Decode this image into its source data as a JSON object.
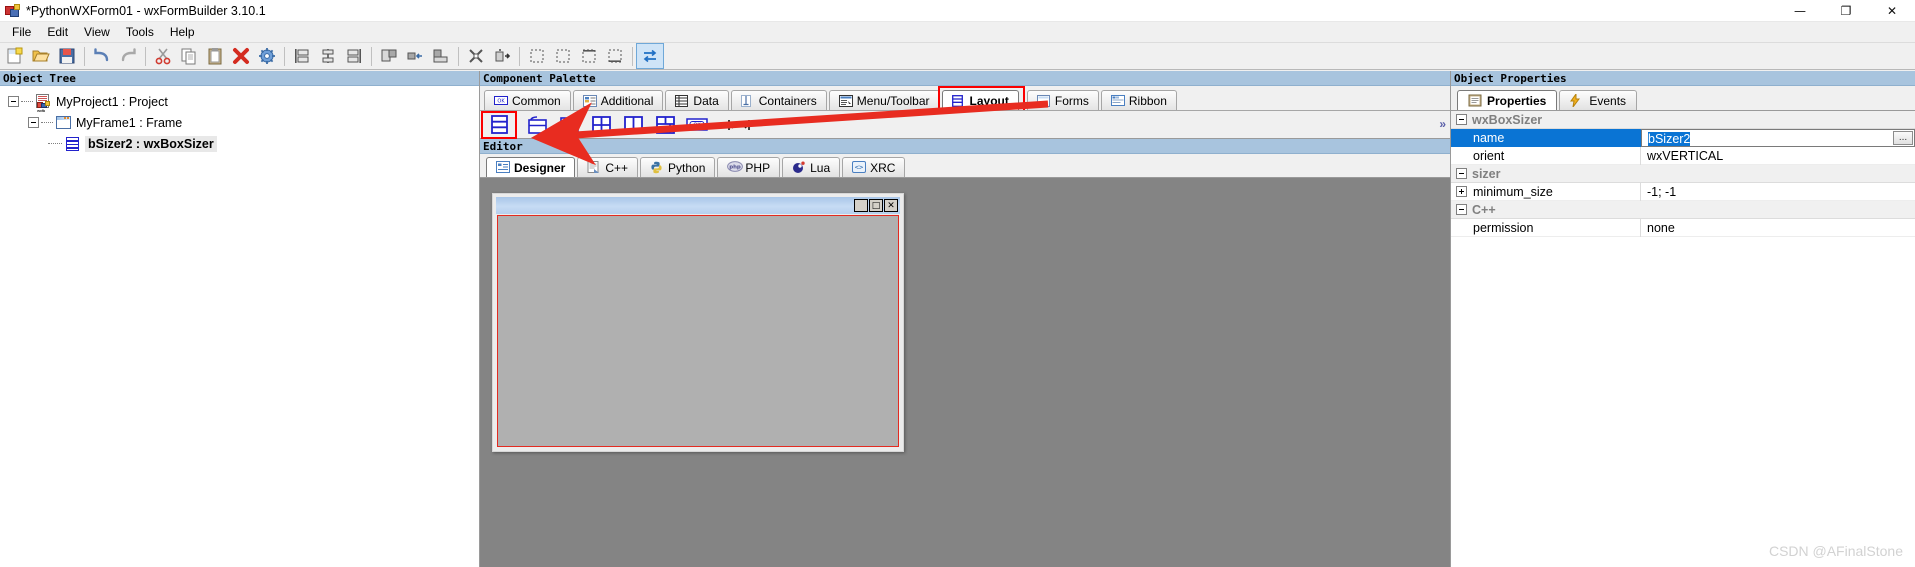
{
  "window": {
    "title": "*PythonWXForm01 - wxFormBuilder 3.10.1",
    "icon": "wxfb-icon",
    "controls": {
      "minimize": "—",
      "maximize": "❐",
      "close": "✕"
    }
  },
  "menubar": {
    "items": [
      {
        "label": "File"
      },
      {
        "label": "Edit"
      },
      {
        "label": "View"
      },
      {
        "label": "Tools"
      },
      {
        "label": "Help"
      }
    ]
  },
  "toolbar": {
    "buttons": [
      {
        "name": "new-project-button",
        "icon": "new-document-icon"
      },
      {
        "name": "open-project-button",
        "icon": "open-folder-icon"
      },
      {
        "name": "save-project-button",
        "icon": "floppy-save-icon"
      },
      {
        "name": "undo-button",
        "icon": "undo-arrow-icon"
      },
      {
        "name": "redo-button",
        "icon": "redo-arrow-icon"
      },
      {
        "name": "cut-button",
        "icon": "scissors-icon"
      },
      {
        "name": "copy-button",
        "icon": "copy-pages-icon"
      },
      {
        "name": "paste-button",
        "icon": "clipboard-icon"
      },
      {
        "name": "delete-button",
        "icon": "red-x-icon"
      },
      {
        "name": "settings-button",
        "icon": "gear-icon"
      },
      {
        "name": "align-left-button",
        "icon": "align-left-icon"
      },
      {
        "name": "align-center-button",
        "icon": "align-center-icon"
      },
      {
        "name": "align-right-button",
        "icon": "align-right-icon"
      },
      {
        "name": "align-top-button",
        "icon": "align-top-icon"
      },
      {
        "name": "align-middle-button",
        "icon": "align-middle-icon"
      },
      {
        "name": "align-bottom-button",
        "icon": "align-bottom-icon"
      },
      {
        "name": "expand-button",
        "icon": "expand-arrows-icon"
      },
      {
        "name": "stretch-button",
        "icon": "stretch-icon"
      },
      {
        "name": "border-left-button",
        "icon": "border-left-icon"
      },
      {
        "name": "border-right-button",
        "icon": "border-right-icon"
      },
      {
        "name": "border-top-button",
        "icon": "border-top-icon"
      },
      {
        "name": "border-bottom-button",
        "icon": "border-bottom-icon"
      },
      {
        "name": "toggle-orient-button",
        "icon": "swap-arrows-icon"
      }
    ]
  },
  "object_tree": {
    "caption": "Object Tree",
    "nodes": [
      {
        "label": "MyProject1 : Project",
        "icon": "project-icon",
        "depth": 0,
        "expanded": true,
        "selected": false
      },
      {
        "label": "MyFrame1 : Frame",
        "icon": "frame-icon",
        "depth": 1,
        "expanded": true,
        "selected": false
      },
      {
        "label": "bSizer2 : wxBoxSizer",
        "icon": "boxsizer-icon",
        "depth": 2,
        "expanded": false,
        "selected": true
      }
    ]
  },
  "component_palette": {
    "caption": "Component Palette",
    "tabs": [
      {
        "label": "Common",
        "icon": "button-widget-icon",
        "selected": false
      },
      {
        "label": "Additional",
        "icon": "list-widget-icon",
        "selected": false
      },
      {
        "label": "Data",
        "icon": "grid-data-icon",
        "selected": false
      },
      {
        "label": "Containers",
        "icon": "container-icon",
        "selected": false
      },
      {
        "label": "Menu/Toolbar",
        "icon": "menubar-icon",
        "selected": false
      },
      {
        "label": "Layout",
        "icon": "boxsizer-icon",
        "selected": true
      },
      {
        "label": "Forms",
        "icon": "form-window-icon",
        "selected": false
      },
      {
        "label": "Ribbon",
        "icon": "ribbon-icon",
        "selected": false
      }
    ],
    "overflow_indicator": "»",
    "items": [
      {
        "name": "wxBoxSizer-button",
        "icon": "boxsizer-icon",
        "selected": true
      },
      {
        "name": "wxStaticBoxSizer-button",
        "icon": "staticboxsizer-icon",
        "selected": false
      },
      {
        "name": "wxWrapSizer-button",
        "icon": "wrapsizer-icon",
        "selected": false
      },
      {
        "name": "wxGridSizer-button",
        "icon": "gridsizer-icon",
        "selected": false
      },
      {
        "name": "wxFlexGridSizer-button",
        "icon": "flexgridsizer-icon",
        "selected": false
      },
      {
        "name": "wxGridBagSizer-button",
        "icon": "gridbagsizer-icon",
        "selected": false
      },
      {
        "name": "wxStdDialogButtonSizer-button",
        "icon": "stddialogbuttonsizer-icon",
        "selected": false
      },
      {
        "name": "spacer-button",
        "icon": "spacer-icon",
        "selected": false
      }
    ]
  },
  "editor": {
    "caption": "Editor",
    "tabs": [
      {
        "label": "Designer",
        "icon": "designer-icon",
        "selected": true
      },
      {
        "label": "C++",
        "icon": "cpp-icon",
        "selected": false
      },
      {
        "label": "Python",
        "icon": "python-icon",
        "selected": false
      },
      {
        "label": "PHP",
        "icon": "php-icon",
        "selected": false
      },
      {
        "label": "Lua",
        "icon": "lua-icon",
        "selected": false
      },
      {
        "label": "XRC",
        "icon": "xrc-icon",
        "selected": false
      }
    ],
    "canvas": {
      "mock_frame": {
        "title": "",
        "buttons": [
          {
            "name": "mock-minimize-button",
            "glyph": "_"
          },
          {
            "name": "mock-maximize-button",
            "glyph": "□"
          },
          {
            "name": "mock-close-button",
            "glyph": "✕"
          }
        ],
        "selected_sizer_outline_color": "#e32a20"
      }
    }
  },
  "object_properties": {
    "caption": "Object Properties",
    "tabs": [
      {
        "label": "Properties",
        "icon": "clipboard-properties-icon",
        "selected": true
      },
      {
        "label": "Events",
        "icon": "lightning-icon",
        "selected": false
      }
    ],
    "grid": [
      {
        "kind": "category",
        "label": "wxBoxSizer",
        "expanded": true
      },
      {
        "kind": "property",
        "name": "name",
        "value": "bSizer2",
        "selected": true,
        "editing": true,
        "has_ellipsis": true
      },
      {
        "kind": "property",
        "name": "orient",
        "value": "wxVERTICAL",
        "selected": false,
        "editing": false,
        "has_ellipsis": false
      },
      {
        "kind": "category",
        "label": "sizer",
        "expanded": true
      },
      {
        "kind": "property",
        "name": "minimum_size",
        "value": "-1; -1",
        "selected": false,
        "editing": false,
        "expandable": true
      },
      {
        "kind": "category",
        "label": "C++",
        "expanded": true
      },
      {
        "kind": "property",
        "name": "permission",
        "value": "none",
        "selected": false,
        "editing": false,
        "has_ellipsis": false
      }
    ]
  },
  "annotations": {
    "highlight_color": "#fb0000",
    "arrow_color": "#e82c20",
    "boxes": [
      {
        "name": "layout-tab-highlight-box"
      },
      {
        "name": "boxsizer-palette-highlight-box"
      }
    ]
  },
  "watermark": {
    "text": "CSDN @AFinalStone"
  },
  "colors": {
    "panel_caption_bg": "#a8c4de",
    "selection_blue": "#0a74d4",
    "canvas_gray": "#848484",
    "toolbar_bg": "#f0f0f0"
  }
}
